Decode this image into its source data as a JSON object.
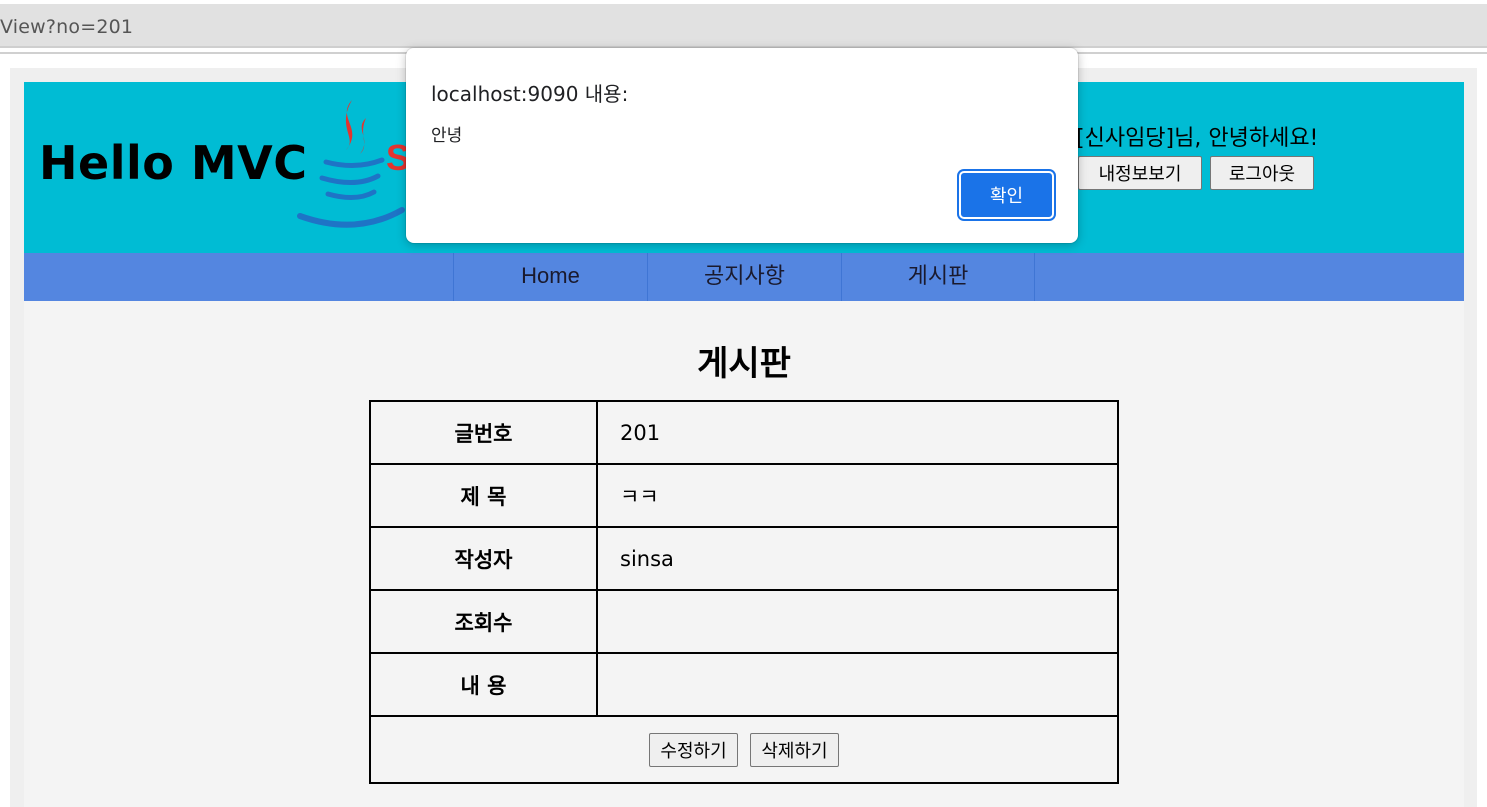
{
  "browser": {
    "url_fragment": "View?no=201"
  },
  "header": {
    "site_title": "Hello MVC",
    "logo_text": "S",
    "greeting": "[신사임당]님, 안녕하세요!",
    "myinfo_label": "내정보보기",
    "logout_label": "로그아웃"
  },
  "nav": {
    "items": [
      {
        "label": "Home"
      },
      {
        "label": "공지사항"
      },
      {
        "label": "게시판"
      }
    ]
  },
  "board": {
    "title": "게시판",
    "rows": [
      {
        "label": "글번호",
        "value": "201"
      },
      {
        "label": "제 목",
        "value": "ㅋㅋ"
      },
      {
        "label": "작성자",
        "value": "sinsa"
      },
      {
        "label": "조회수",
        "value": ""
      },
      {
        "label": "내 용",
        "value": ""
      }
    ],
    "edit_label": "수정하기",
    "delete_label": "삭제하기"
  },
  "alert": {
    "title": "localhost:9090 내용:",
    "message": "안녕",
    "ok_label": "확인"
  },
  "colors": {
    "header_bg": "#00bcd4",
    "nav_bg": "#5486e0",
    "alert_button": "#1a73e8",
    "java_logo_red": "#e3342f",
    "java_logo_blue": "#1e74c6"
  }
}
